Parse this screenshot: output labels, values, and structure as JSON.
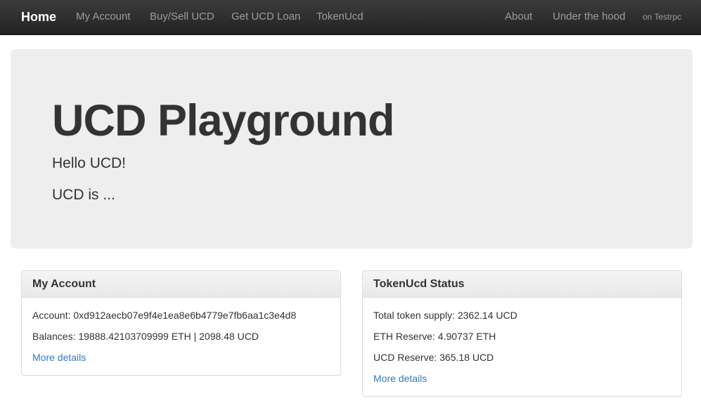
{
  "navbar": {
    "brand": "Home",
    "left_items": [
      "My Account",
      "Buy/Sell UCD",
      "Get UCD Loan",
      "TokenUcd"
    ],
    "right_items": [
      "About",
      "Under the hood"
    ],
    "network": "on Testrpc"
  },
  "jumbotron": {
    "title": "UCD Playground",
    "greeting": "Hello UCD!",
    "tagline": "UCD is ..."
  },
  "my_account": {
    "heading": "My Account",
    "account": "Account: 0xd912aecb07e9f4e1ea8e6b4779e7fb6aa1c3e4d8",
    "balances": "Balances: 19888.42103709999 ETH | 2098.48 UCD",
    "more_details": "More details"
  },
  "token_status": {
    "heading": "TokenUcd Status",
    "total_supply": "Total token supply: 2362.14 UCD",
    "eth_reserve": "ETH Reserve: 4.90737 ETH",
    "ucd_reserve": "UCD Reserve: 365.18 UCD",
    "more_details": "More details"
  },
  "colors": {
    "navbar_bg": "#222222",
    "nav_text": "#9d9d9d",
    "jumbotron_bg": "#eeeeee",
    "link": "#337ab7"
  }
}
